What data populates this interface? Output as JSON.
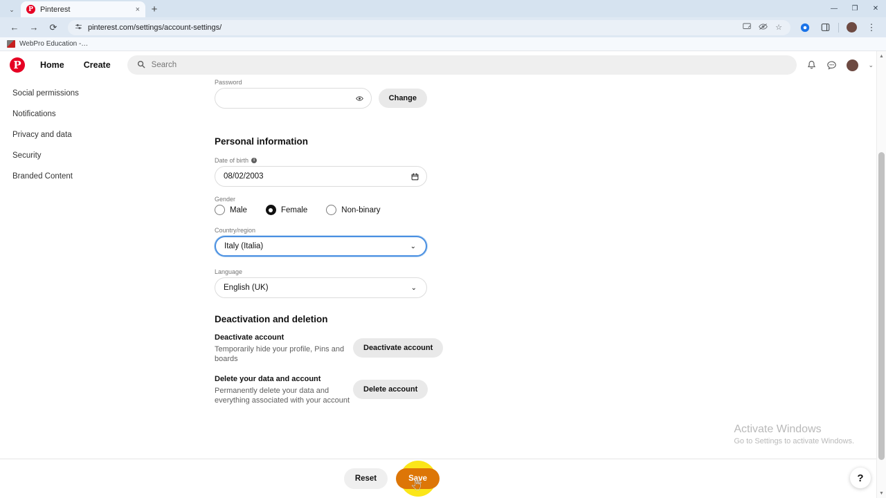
{
  "browser": {
    "tab": {
      "title": "Pinterest",
      "favicon_icon": "pinterest-favicon",
      "close_icon": "×"
    },
    "tab_list_chevron_icon": "⌄",
    "new_tab_icon": "+",
    "window_controls": {
      "minimize": "—",
      "maximize": "❐",
      "close": "✕"
    },
    "nav": {
      "back_icon": "←",
      "forward_icon": "→",
      "reload_icon": "⟳"
    },
    "omnibox": {
      "site_settings_icon": "site-settings-icon",
      "url": "pinterest.com/settings/account-settings/",
      "cast_icon": "screen-cast-icon",
      "tracking_icon": "tracking-protection-icon",
      "bookmark_icon": "☆"
    },
    "toolbar_right": {
      "extension_icon": "extensions-puzzle-icon",
      "sidepanel_icon": "side-panel-icon",
      "profile_icon": "profile-avatar",
      "menu_icon": "⋮"
    },
    "bookmarks": [
      {
        "label": "WebPro Education -…",
        "favicon": "webpro-favicon"
      }
    ]
  },
  "pinterest_header": {
    "logo_letter": "P",
    "nav": [
      {
        "label": "Home"
      },
      {
        "label": "Create"
      }
    ],
    "search": {
      "placeholder": "Search",
      "icon": "search-icon",
      "value": ""
    },
    "actions": {
      "notifications_icon": "bell-icon",
      "messages_icon": "chat-bubble-icon",
      "avatar": "user-avatar",
      "caret_icon": "⌄"
    }
  },
  "sidebar": {
    "items": [
      {
        "label": "Social permissions"
      },
      {
        "label": "Notifications"
      },
      {
        "label": "Privacy and data"
      },
      {
        "label": "Security"
      },
      {
        "label": "Branded Content"
      }
    ]
  },
  "main": {
    "password": {
      "label": "Password",
      "value": "",
      "reveal_icon": "eye-icon",
      "change_button": "Change"
    },
    "personal_information": {
      "heading": "Personal information",
      "date_of_birth": {
        "label": "Date of birth",
        "info_icon": "i",
        "value": "08/02/2003",
        "calendar_icon": "calendar-icon"
      },
      "gender": {
        "label": "Gender",
        "options": [
          {
            "label": "Male",
            "selected": false
          },
          {
            "label": "Female",
            "selected": true
          },
          {
            "label": "Non-binary",
            "selected": false
          }
        ]
      },
      "country": {
        "label": "Country/region",
        "value": "Italy (Italia)",
        "caret_icon": "⌄",
        "focused": true
      },
      "language": {
        "label": "Language",
        "value": "English (UK)",
        "caret_icon": "⌄",
        "focused": false
      }
    },
    "deactivation": {
      "heading": "Deactivation and deletion",
      "deactivate": {
        "title": "Deactivate account",
        "description": "Temporarily hide your profile, Pins and boards",
        "button": "Deactivate account"
      },
      "delete": {
        "title": "Delete your data and account",
        "description": "Permanently delete your data and everything associated with your account",
        "button": "Delete account"
      }
    }
  },
  "bottom_bar": {
    "reset_button": "Reset",
    "save_button": "Save",
    "save_highlighted": true
  },
  "help_button": {
    "label": "?"
  },
  "watermark": {
    "title": "Activate Windows",
    "subtitle": "Go to Settings to activate Windows."
  },
  "colors": {
    "pinterest_red": "#e60023",
    "save_button_bg": "#dd7607",
    "click_halo": "#fbe619",
    "focus_blue": "#4a90e2",
    "chrome_tabstrip": "#d6e3f0"
  }
}
